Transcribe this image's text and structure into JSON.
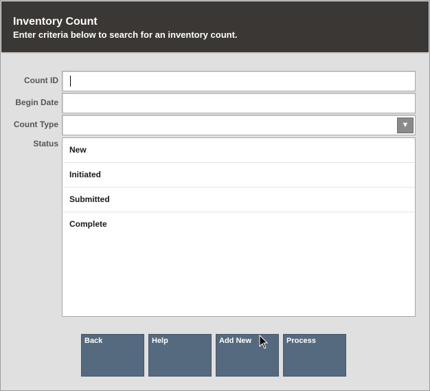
{
  "header": {
    "title": "Inventory Count",
    "subtitle": "Enter criteria below to search for an inventory count."
  },
  "form": {
    "count_id": {
      "label": "Count ID",
      "value": ""
    },
    "begin_date": {
      "label": "Begin Date",
      "value": ""
    },
    "count_type": {
      "label": "Count Type",
      "value": "",
      "arrow_icon": "chevron-down-icon"
    },
    "status": {
      "label": "Status",
      "options": [
        "New",
        "Initiated",
        "Submitted",
        "Complete"
      ]
    }
  },
  "buttons": {
    "back": "Back",
    "help": "Help",
    "add_new": "Add New",
    "process": "Process"
  },
  "colors": {
    "header_bg": "#3b3734",
    "button_bg": "#566a7f",
    "page_bg": "#e0e0e0"
  }
}
